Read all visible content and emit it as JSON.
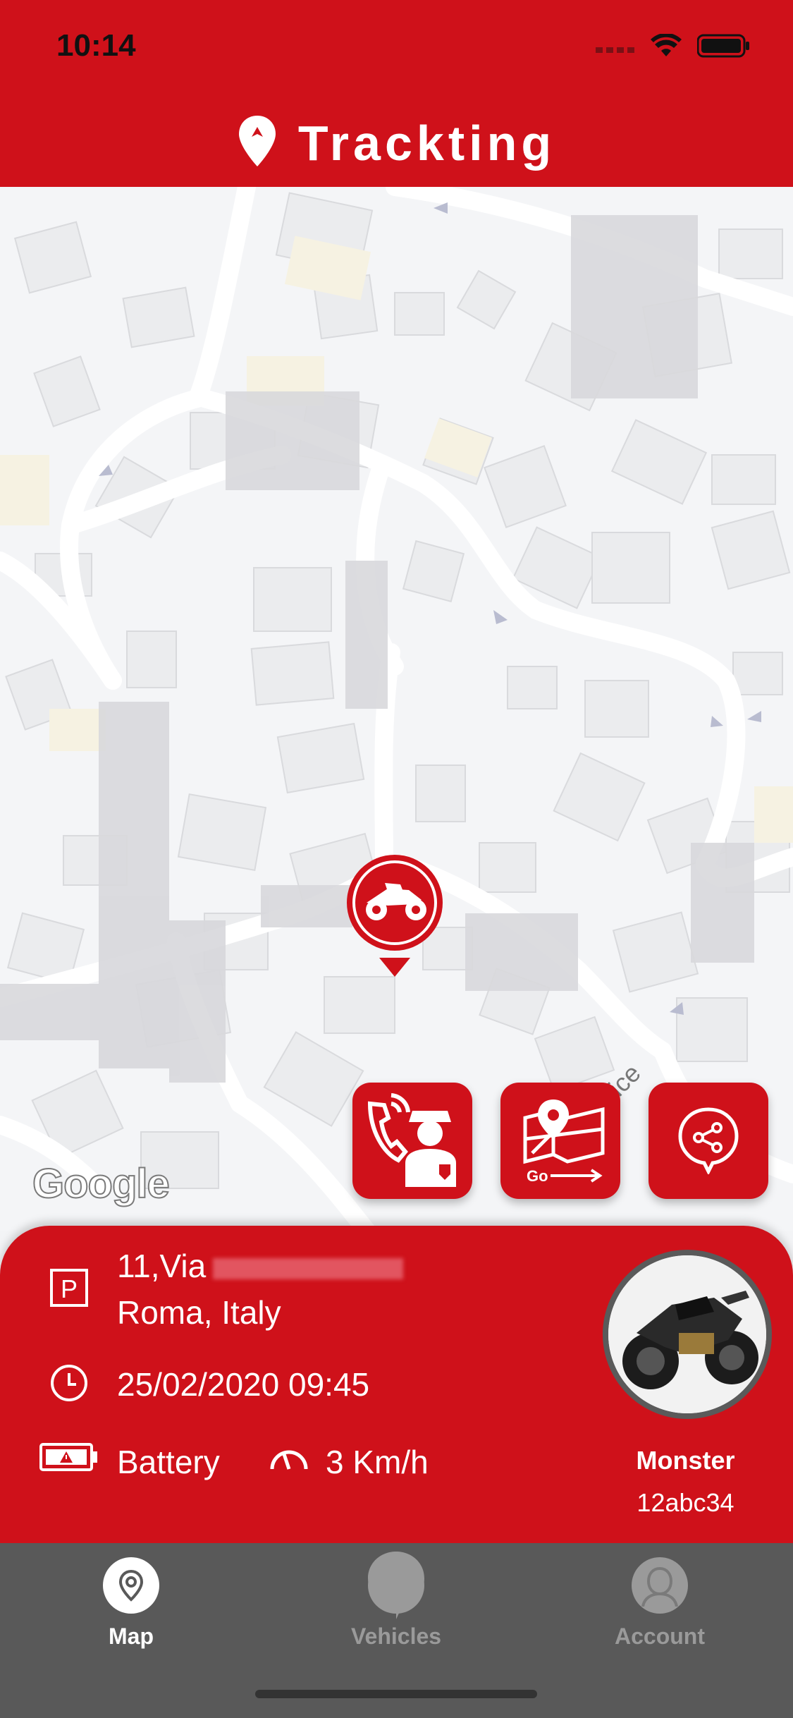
{
  "status": {
    "time": "10:14"
  },
  "header": {
    "title": "Trackting"
  },
  "map": {
    "attribution": "Google",
    "street_fragment": "rice"
  },
  "actions": [
    {
      "name": "call-police",
      "label": ""
    },
    {
      "name": "navigate",
      "label": "Go"
    },
    {
      "name": "share",
      "label": ""
    }
  ],
  "card": {
    "address_line1": "11,Via",
    "address_line2": "Roma, Italy",
    "datetime": "25/02/2020 09:45",
    "battery_label": "Battery",
    "speed": "3 Km/h",
    "vehicle_name": "Monster",
    "vehicle_plate": "12abc34",
    "parking_icon_letter": "P"
  },
  "tabs": [
    {
      "label": "Map",
      "active": true
    },
    {
      "label": "Vehicles",
      "active": false
    },
    {
      "label": "Account",
      "active": false
    }
  ],
  "colors": {
    "brand_red": "#cf111a",
    "tabbar": "#595959",
    "inactive": "#9a9a9a"
  }
}
